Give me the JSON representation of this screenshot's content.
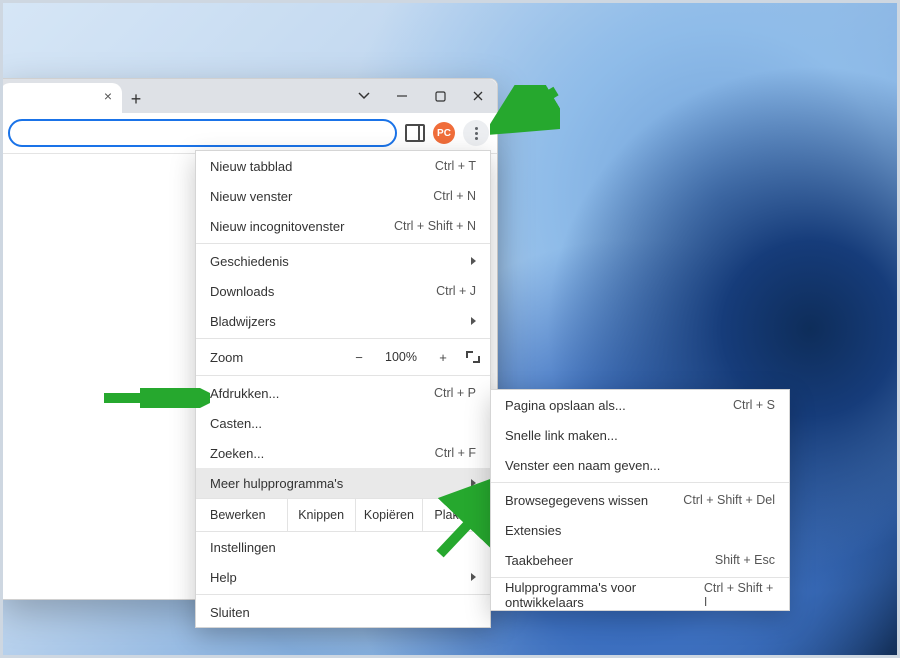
{
  "avatar_initials": "PC",
  "main_menu": {
    "new_tab": {
      "label": "Nieuw tabblad",
      "shortcut": "Ctrl + T"
    },
    "new_window": {
      "label": "Nieuw venster",
      "shortcut": "Ctrl + N"
    },
    "new_incognito": {
      "label": "Nieuw incognitovenster",
      "shortcut": "Ctrl + Shift + N"
    },
    "history": {
      "label": "Geschiedenis"
    },
    "downloads": {
      "label": "Downloads",
      "shortcut": "Ctrl + J"
    },
    "bookmarks": {
      "label": "Bladwijzers"
    },
    "zoom": {
      "label": "Zoom",
      "percent": "100%",
      "minus": "−",
      "plus": "+"
    },
    "print": {
      "label": "Afdrukken...",
      "shortcut": "Ctrl + P"
    },
    "cast": {
      "label": "Casten..."
    },
    "find": {
      "label": "Zoeken...",
      "shortcut": "Ctrl + F"
    },
    "more_tools": {
      "label": "Meer hulpprogramma's"
    },
    "edit": {
      "label": "Bewerken",
      "cut": "Knippen",
      "copy": "Kopiëren",
      "paste": "Plakken"
    },
    "settings": {
      "label": "Instellingen"
    },
    "help": {
      "label": "Help"
    },
    "close": {
      "label": "Sluiten"
    }
  },
  "sub_menu": {
    "save_page": {
      "label": "Pagina opslaan als...",
      "shortcut": "Ctrl + S"
    },
    "create_shortcut": {
      "label": "Snelle link maken..."
    },
    "name_window": {
      "label": "Venster een naam geven..."
    },
    "clear_data": {
      "label": "Browsegegevens wissen",
      "shortcut": "Ctrl + Shift + Del"
    },
    "extensions": {
      "label": "Extensies"
    },
    "task_manager": {
      "label": "Taakbeheer",
      "shortcut": "Shift + Esc"
    },
    "devtools": {
      "label": "Hulpprogramma's voor ontwikkelaars",
      "shortcut": "Ctrl + Shift + I"
    }
  },
  "arrow_color": "#26a82e"
}
